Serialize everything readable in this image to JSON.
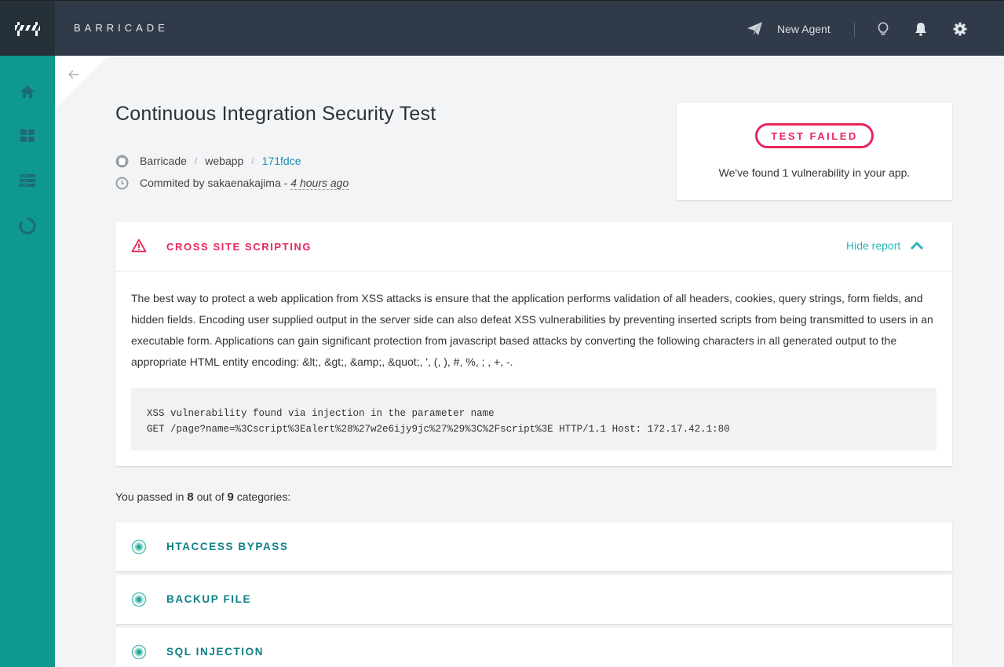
{
  "app": {
    "brand": "BARRICADE",
    "logo_icon": "barricade-logo-icon"
  },
  "topbar": {
    "new_agent_label": "New Agent",
    "icons": [
      "paper-plane-icon",
      "lightbulb-icon",
      "bell-icon",
      "gear-icon"
    ]
  },
  "sidebar": {
    "items": [
      "home-icon",
      "dashboard-grid-icon",
      "server-stack-icon",
      "loading-ring-icon"
    ]
  },
  "test": {
    "title": "Continuous Integration Security Test",
    "repo_owner": "Barricade",
    "repo_name": "webapp",
    "commit_hash": "171fdce",
    "commit_prefix": "Commited by sakaenakajima -",
    "commit_time": "4 hours ago"
  },
  "result": {
    "badge": "TEST FAILED",
    "message": "We've found 1 vulnerability in your app."
  },
  "vulnerability": {
    "title": "CROSS SITE SCRIPTING",
    "toggle_label": "Hide report",
    "description": "The best way to protect a web application from XSS attacks is ensure that the application performs validation of all headers, cookies, query strings, form fields, and hidden fields. Encoding user supplied output in the server side can also defeat XSS vulnerabilities by preventing inserted scripts from being transmitted to users in an executable form. Applications can gain significant protection from javascript based attacks by converting the following characters in all generated output to the appropriate HTML entity encoding: &lt;, &gt;, &amp;, &quot;, ', (, ), #, %, ; , +, -.",
    "code_line1": "XSS vulnerability found via injection in the parameter name",
    "code_line2": "GET /page?name=%3Cscript%3Ealert%28%27w2e6ijy9jc%27%29%3C%2Fscript%3E HTTP/1.1 Host: 172.17.42.1:80"
  },
  "summary": {
    "prefix": "You passed in",
    "passed": "8",
    "middle": "out of",
    "total": "9",
    "suffix": "categories:"
  },
  "categories": [
    {
      "title": "HTACCESS BYPASS"
    },
    {
      "title": "BACKUP FILE"
    },
    {
      "title": "SQL INJECTION"
    }
  ],
  "colors": {
    "topbar": "#303a48",
    "sidebar": "#0e9890",
    "danger": "#e8265a",
    "teal_text": "#0c7f86",
    "link": "#1a8fb0"
  }
}
